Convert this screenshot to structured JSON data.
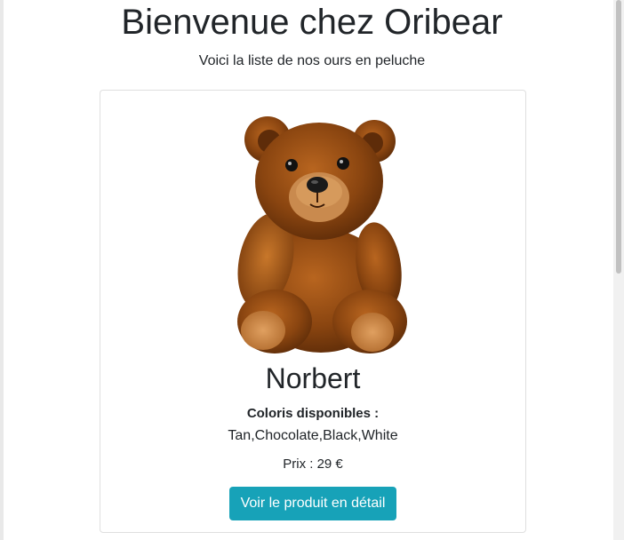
{
  "header": {
    "title": "Bienvenue chez Oribear",
    "subtitle": "Voici la liste de nos ours en peluche"
  },
  "product": {
    "image_alt": "Ours en peluche Norbert",
    "name": "Norbert",
    "colors_heading": "Coloris disponibles :",
    "colors": "Tan,Chocolate,Black,White",
    "price": "Prix : 29 €",
    "detail_button_label": "Voir le produit en détail"
  },
  "colors": {
    "button": "#17a2b8",
    "text": "#212529",
    "bear_fur": "#8a4510"
  }
}
